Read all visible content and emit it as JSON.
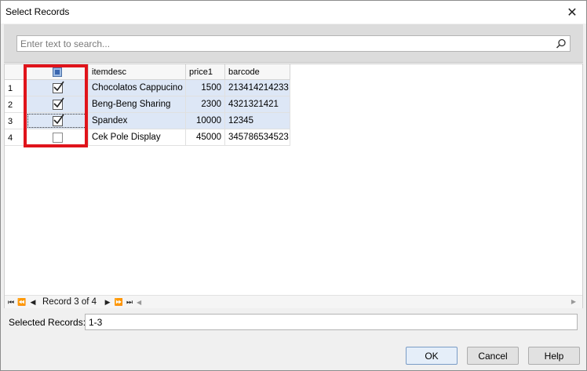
{
  "window": {
    "title": "Select Records"
  },
  "search": {
    "placeholder": "Enter text to search..."
  },
  "grid": {
    "columns": {
      "itemdesc": "itemdesc",
      "price1": "price1",
      "barcode": "barcode"
    },
    "rows": [
      {
        "num": "1",
        "checked": true,
        "itemdesc": "Chocolatos Cappucino",
        "price1": "1500",
        "barcode": "213414214233"
      },
      {
        "num": "2",
        "checked": true,
        "itemdesc": "Beng-Beng Sharing",
        "price1": "2300",
        "barcode": "4321321421"
      },
      {
        "num": "3",
        "checked": true,
        "itemdesc": "Spandex",
        "price1": "10000",
        "barcode": "12345"
      },
      {
        "num": "4",
        "checked": false,
        "itemdesc": "Cek Pole Display",
        "price1": "45000",
        "barcode": "345786534523"
      }
    ]
  },
  "navigator": {
    "record_text": "Record 3 of 4"
  },
  "selection": {
    "label": "Selected Records:",
    "value": "1-3"
  },
  "buttons": {
    "ok": "OK",
    "cancel": "Cancel",
    "help": "Help"
  },
  "colors": {
    "highlight": "#e0141b",
    "selected_row": "#dde7f6"
  }
}
